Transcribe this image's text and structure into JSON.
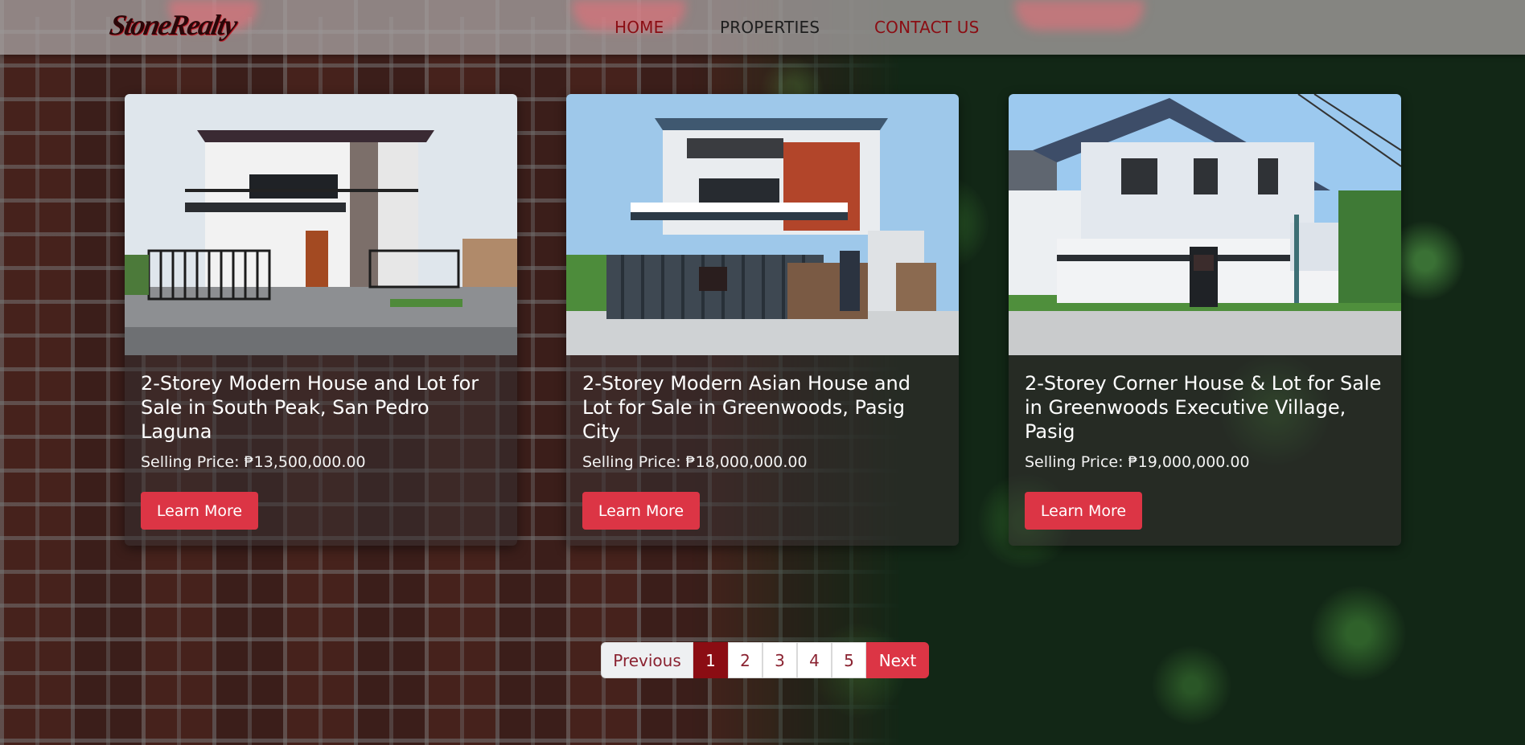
{
  "colors": {
    "accent": "#dc3545",
    "active_page": "#8b0d13",
    "nav_active": "#8b0d13",
    "nav_text": "#1e1e1e"
  },
  "brand": {
    "logo_text": "StoneRealty"
  },
  "nav": {
    "items": [
      {
        "label": "HOME",
        "active": true
      },
      {
        "label": "PROPERTIES",
        "active": false
      },
      {
        "label": "CONTACT US",
        "active": false
      }
    ]
  },
  "listings": [
    {
      "title": "2-Storey Modern House and Lot for Sale in South Peak, San Pedro Laguna",
      "price": "Selling Price: ₱13,500,000.00",
      "button": "Learn More"
    },
    {
      "title": "2-Storey Modern Asian House and Lot for Sale in Greenwoods, Pasig City",
      "price": "Selling Price: ₱18,000,000.00",
      "button": "Learn More"
    },
    {
      "title": "2-Storey Corner House & Lot for Sale in Greenwoods Executive Village, Pasig",
      "price": "Selling Price: ₱19,000,000.00",
      "button": "Learn More"
    }
  ],
  "pagination": {
    "previous": "Previous",
    "pages": [
      "1",
      "2",
      "3",
      "4",
      "5"
    ],
    "current": "1",
    "next": "Next"
  }
}
